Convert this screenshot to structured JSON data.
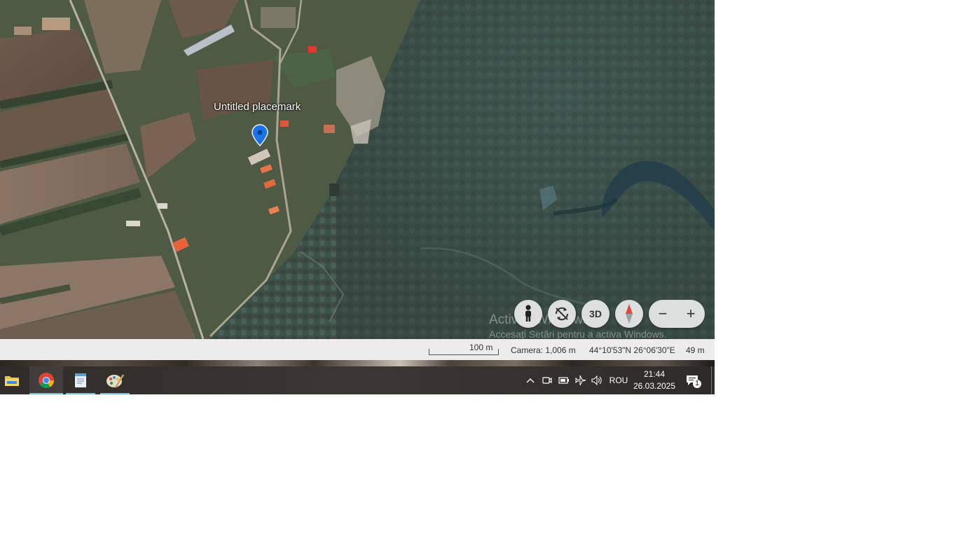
{
  "map": {
    "placemark_label": "Untitled placemark",
    "controls": {
      "threed_label": "3D",
      "zoom_out_label": "−",
      "zoom_in_label": "+"
    },
    "icons": {
      "pegman": "pegman-icon",
      "rotate": "rotate-icon",
      "compass": "compass-icon",
      "placemark": "placemark-pin-icon"
    },
    "watermark": {
      "title": "Activați Windows",
      "subtitle": "Accesați Setări pentru a activa Windows."
    }
  },
  "statusbar": {
    "scale_label": "100 m",
    "camera_label": "Camera: 1,006 m",
    "coords_label": "44°10'53\"N 26°06'30\"E",
    "elevation_label": "49 m"
  },
  "taskbar": {
    "apps": [
      {
        "name": "file-explorer",
        "icon": "folder-icon"
      },
      {
        "name": "chrome",
        "icon": "chrome-icon"
      },
      {
        "name": "notepad",
        "icon": "notepad-icon"
      },
      {
        "name": "paint",
        "icon": "paint-palette-icon"
      }
    ],
    "tray": {
      "language": "ROU",
      "time": "21:44",
      "date": "26.03.2025",
      "notification_count": "1"
    }
  },
  "colors": {
    "accent": "#76b9ed",
    "pin": "#1a73e8",
    "statusbar_bg": "#ececec",
    "taskbar_bg": "#3b3733"
  }
}
